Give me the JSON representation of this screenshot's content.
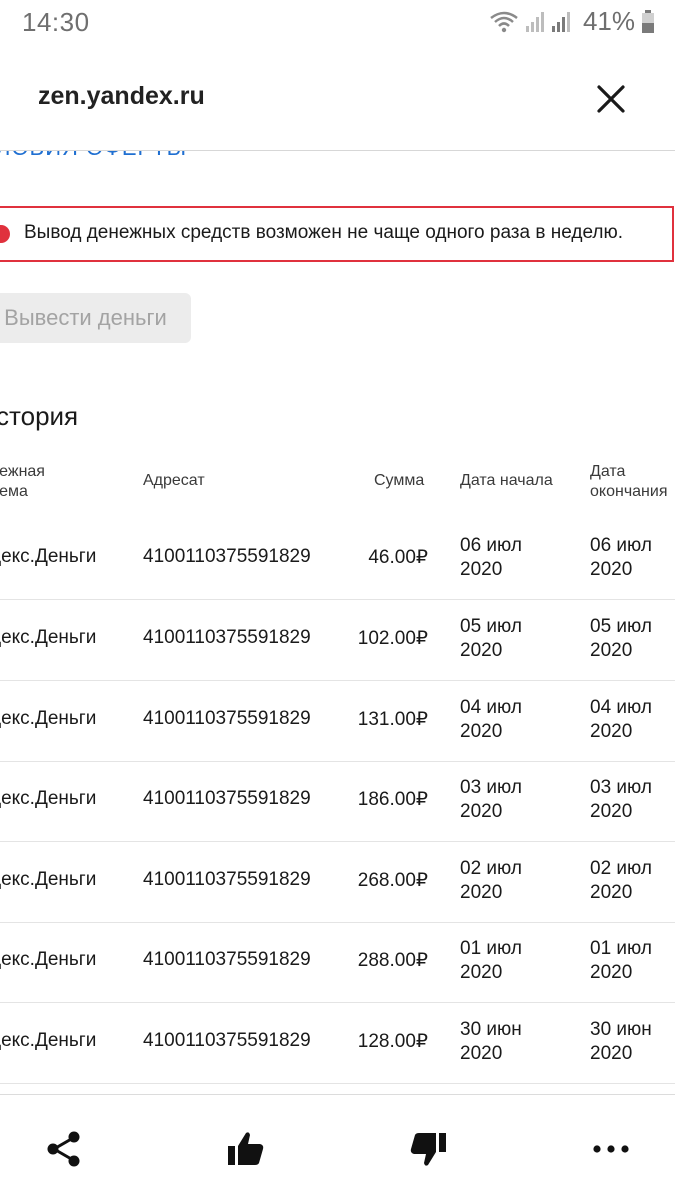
{
  "status_bar": {
    "time": "14:30",
    "battery": "41%"
  },
  "header": {
    "url": "zen.yandex.ru"
  },
  "content": {
    "offer_link": "ЛОВИЯ ОФЕРТЫ",
    "warning": "Вывод денежных средств возможен не чаще одного раза в неделю.",
    "withdraw_button": "Вывести деньги",
    "history_title": "стория",
    "table": {
      "headers": {
        "system": "тежная\nтема",
        "recipient": "Адресат",
        "amount": "Сумма",
        "start_date": "Дата начала",
        "end_date": "Дата\nокончания"
      },
      "rows": [
        {
          "system": "декс.Деньги",
          "recipient": "4100110375591829",
          "amount": "46.00₽",
          "start": "06 июл 2020",
          "end": "06 июл 2020"
        },
        {
          "system": "декс.Деньги",
          "recipient": "4100110375591829",
          "amount": "102.00₽",
          "start": "05 июл 2020",
          "end": "05 июл 2020"
        },
        {
          "system": "декс.Деньги",
          "recipient": "4100110375591829",
          "amount": "131.00₽",
          "start": "04 июл 2020",
          "end": "04 июл 2020"
        },
        {
          "system": "декс.Деньги",
          "recipient": "4100110375591829",
          "amount": "186.00₽",
          "start": "03 июл 2020",
          "end": "03 июл 2020"
        },
        {
          "system": "декс.Деньги",
          "recipient": "4100110375591829",
          "amount": "268.00₽",
          "start": "02 июл 2020",
          "end": "02 июл 2020"
        },
        {
          "system": "декс.Деньги",
          "recipient": "4100110375591829",
          "amount": "288.00₽",
          "start": "01 июл 2020",
          "end": "01 июл 2020"
        },
        {
          "system": "декс.Деньги",
          "recipient": "4100110375591829",
          "amount": "128.00₽",
          "start": "30 июн 2020",
          "end": "30 июн 2020"
        }
      ]
    }
  },
  "bottom_bar": {
    "icons": [
      "share-icon",
      "thumbs-up-icon",
      "thumbs-down-icon",
      "more-icon"
    ]
  },
  "colors": {
    "accent_link": "#1f6fd1",
    "warning": "#e0313d",
    "text": "#1a1a1a"
  }
}
